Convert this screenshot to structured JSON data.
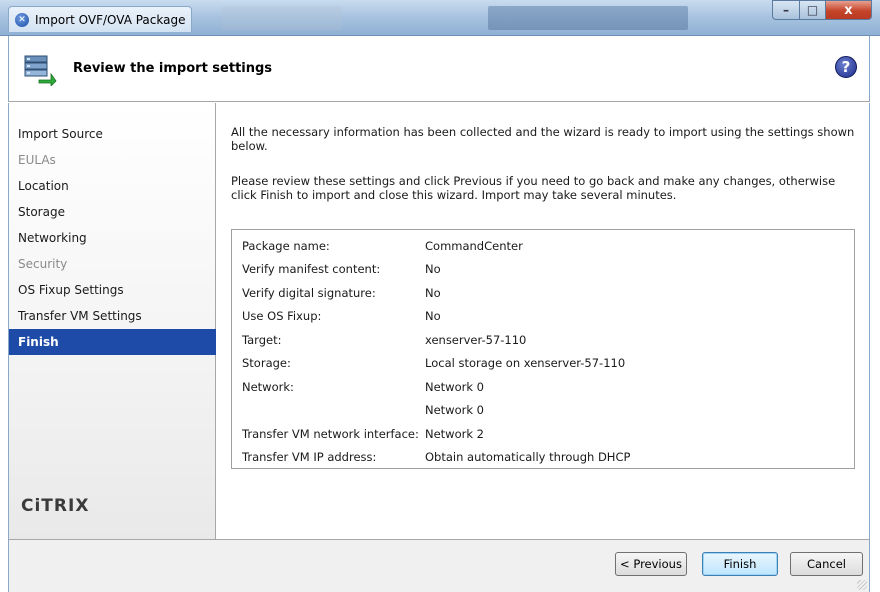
{
  "window": {
    "title": "Import OVF/OVA Package",
    "controls": {
      "minimize": "–",
      "maximize": "□",
      "close": "x"
    }
  },
  "header": {
    "title": "Review the import settings",
    "help": "?"
  },
  "sidebar": {
    "items": [
      {
        "label": "Import Source",
        "state": "normal"
      },
      {
        "label": "EULAs",
        "state": "disabled"
      },
      {
        "label": "Location",
        "state": "normal"
      },
      {
        "label": "Storage",
        "state": "normal"
      },
      {
        "label": "Networking",
        "state": "normal"
      },
      {
        "label": "Security",
        "state": "disabled"
      },
      {
        "label": "OS Fixup Settings",
        "state": "normal"
      },
      {
        "label": "Transfer VM Settings",
        "state": "normal"
      },
      {
        "label": "Finish",
        "state": "selected"
      }
    ],
    "logo": "CiTRIX"
  },
  "main": {
    "intro": "All the necessary information has been collected and the wizard is ready to import using the settings shown below.",
    "instructions": "Please review these settings and click Previous if you need to go back and make any changes, otherwise click Finish to import and close this wizard.  Import may take several minutes.",
    "summary": [
      {
        "key": "Package name:",
        "value": "CommandCenter"
      },
      {
        "key": "Verify manifest content:",
        "value": "No"
      },
      {
        "key": "Verify digital signature:",
        "value": "No"
      },
      {
        "key": "Use OS Fixup:",
        "value": "No"
      },
      {
        "key": "Target:",
        "value": "xenserver-57-110"
      },
      {
        "key": "Storage:",
        "value": "Local storage on xenserver-57-110"
      },
      {
        "key": "Network:",
        "value": "Network 0"
      },
      {
        "key": "",
        "value": "Network 0"
      },
      {
        "key": "Transfer VM network interface:",
        "value": "Network 2"
      },
      {
        "key": "Transfer VM IP address:",
        "value": "Obtain automatically through DHCP"
      }
    ]
  },
  "footer": {
    "previous": "< Previous",
    "finish": "Finish",
    "cancel": "Cancel"
  },
  "colors": {
    "selection": "#1e4aa8",
    "close_button": "#c5442a"
  }
}
